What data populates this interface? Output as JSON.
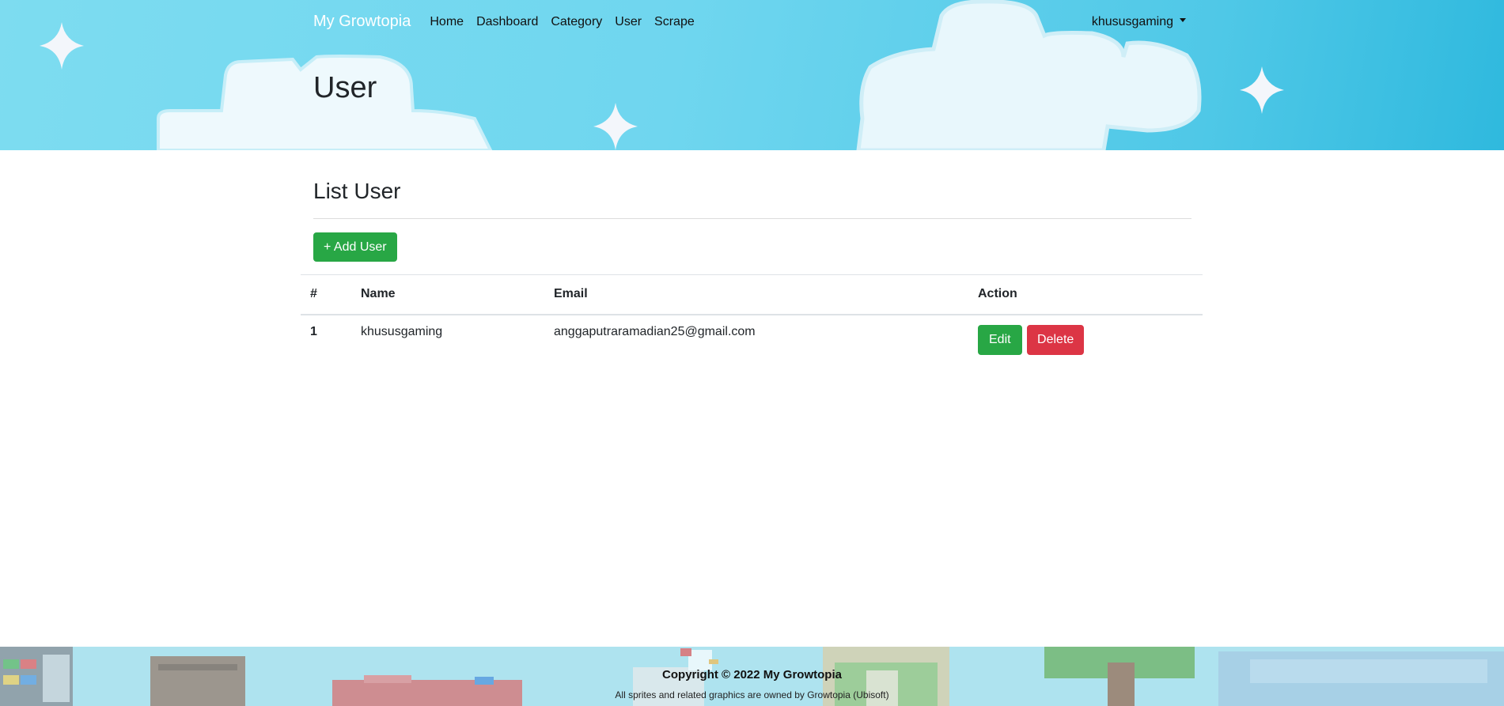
{
  "navbar": {
    "brand": "My Growtopia",
    "links": [
      "Home",
      "Dashboard",
      "Category",
      "User",
      "Scrape"
    ],
    "user_menu": "khususgaming"
  },
  "hero": {
    "title": "User"
  },
  "main": {
    "section_title": "List User",
    "add_button": "+ Add User",
    "table": {
      "headers": [
        "#",
        "Name",
        "Email",
        "Action"
      ],
      "rows": [
        {
          "num": "1",
          "name": "khususgaming",
          "email": "anggaputraramadian25@gmail.com",
          "edit_label": "Edit",
          "delete_label": "Delete"
        }
      ]
    }
  },
  "footer": {
    "copyright": "Copyright © 2022 My Growtopia",
    "credits": "All sprites and related graphics are owned by Growtopia (Ubisoft)"
  },
  "colors": {
    "success": "#28a745",
    "danger": "#dc3545",
    "sky": "#6fd6ef"
  }
}
